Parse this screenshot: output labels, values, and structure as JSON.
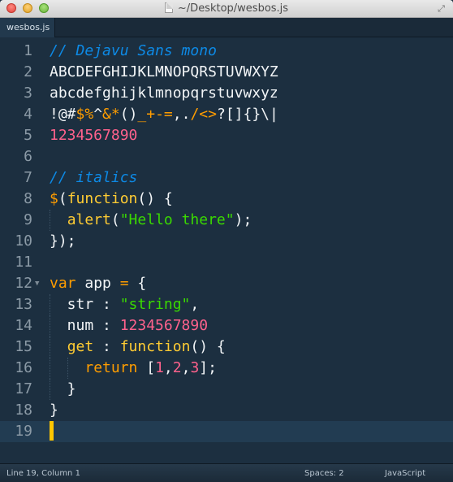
{
  "window": {
    "title": "~/Desktop/wesbos.js",
    "fullscreen_icon": "expand-arrows-icon"
  },
  "tabs": [
    {
      "label": "wesbos.js",
      "active": true
    }
  ],
  "editor": {
    "current_line": 19,
    "lines": [
      {
        "num": "1",
        "fold": "",
        "tokens": [
          {
            "t": "// Dejavu Sans mono",
            "c": "comment"
          }
        ]
      },
      {
        "num": "2",
        "fold": "",
        "tokens": [
          {
            "t": "ABCDEFGHIJKLMNOPQRSTUVWXYZ",
            "c": "white"
          }
        ]
      },
      {
        "num": "3",
        "fold": "",
        "tokens": [
          {
            "t": "abcdefghijklmnopqrstuvwxyz",
            "c": "white"
          }
        ]
      },
      {
        "num": "4",
        "fold": "",
        "tokens": [
          {
            "t": "!@#",
            "c": "white"
          },
          {
            "t": "$%",
            "c": "orange"
          },
          {
            "t": "^",
            "c": "white"
          },
          {
            "t": "&*",
            "c": "orange"
          },
          {
            "t": "()",
            "c": "white"
          },
          {
            "t": "_+-=",
            "c": "orange"
          },
          {
            "t": ",.",
            "c": "white"
          },
          {
            "t": "/<>",
            "c": "orange"
          },
          {
            "t": "?[]{}\\|",
            "c": "white"
          }
        ]
      },
      {
        "num": "5",
        "fold": "",
        "tokens": [
          {
            "t": "1234567890",
            "c": "pink"
          }
        ]
      },
      {
        "num": "6",
        "fold": "",
        "tokens": []
      },
      {
        "num": "7",
        "fold": "",
        "tokens": [
          {
            "t": "// italics",
            "c": "comment"
          }
        ]
      },
      {
        "num": "8",
        "fold": "",
        "tokens": [
          {
            "t": "$",
            "c": "orange"
          },
          {
            "t": "(",
            "c": "white"
          },
          {
            "t": "function",
            "c": "yellow"
          },
          {
            "t": "() {",
            "c": "white"
          }
        ]
      },
      {
        "num": "9",
        "fold": "",
        "tokens": [
          {
            "t": "  ",
            "c": "white"
          },
          {
            "t": "alert",
            "c": "yellow"
          },
          {
            "t": "(",
            "c": "white"
          },
          {
            "t": "\"Hello there\"",
            "c": "green"
          },
          {
            "t": ");",
            "c": "white"
          }
        ]
      },
      {
        "num": "10",
        "fold": "",
        "tokens": [
          {
            "t": "});",
            "c": "white"
          }
        ]
      },
      {
        "num": "11",
        "fold": "",
        "tokens": []
      },
      {
        "num": "12",
        "fold": "▼",
        "tokens": [
          {
            "t": "var",
            "c": "orange"
          },
          {
            "t": " app ",
            "c": "white"
          },
          {
            "t": "=",
            "c": "orange"
          },
          {
            "t": " {",
            "c": "white"
          }
        ]
      },
      {
        "num": "13",
        "fold": "",
        "tokens": [
          {
            "t": "  str : ",
            "c": "white"
          },
          {
            "t": "\"string\"",
            "c": "green"
          },
          {
            "t": ",",
            "c": "white"
          }
        ]
      },
      {
        "num": "14",
        "fold": "",
        "tokens": [
          {
            "t": "  num : ",
            "c": "white"
          },
          {
            "t": "1234567890",
            "c": "pink"
          }
        ]
      },
      {
        "num": "15",
        "fold": "",
        "tokens": [
          {
            "t": "  ",
            "c": "white"
          },
          {
            "t": "get",
            "c": "yellow"
          },
          {
            "t": " : ",
            "c": "white"
          },
          {
            "t": "function",
            "c": "yellow"
          },
          {
            "t": "() {",
            "c": "white"
          }
        ]
      },
      {
        "num": "16",
        "fold": "",
        "tokens": [
          {
            "t": "    ",
            "c": "white"
          },
          {
            "t": "return",
            "c": "orange"
          },
          {
            "t": " [",
            "c": "white"
          },
          {
            "t": "1",
            "c": "pink"
          },
          {
            "t": ",",
            "c": "white"
          },
          {
            "t": "2",
            "c": "pink"
          },
          {
            "t": ",",
            "c": "white"
          },
          {
            "t": "3",
            "c": "pink"
          },
          {
            "t": "];",
            "c": "white"
          }
        ]
      },
      {
        "num": "17",
        "fold": "",
        "tokens": [
          {
            "t": "  }",
            "c": "white"
          }
        ]
      },
      {
        "num": "18",
        "fold": "",
        "tokens": [
          {
            "t": "}",
            "c": "white"
          }
        ]
      },
      {
        "num": "19",
        "fold": "",
        "tokens": []
      }
    ]
  },
  "statusbar": {
    "position": "Line 19, Column 1",
    "spaces": "Spaces: 2",
    "syntax": "JavaScript"
  },
  "colors": {
    "background": "#1c2f40",
    "comment": "#0d8ae6",
    "orange": "#ff9d00",
    "pink": "#ff628c",
    "yellow": "#ffcc33",
    "green": "#3ad900",
    "cursor": "#ffc600"
  }
}
